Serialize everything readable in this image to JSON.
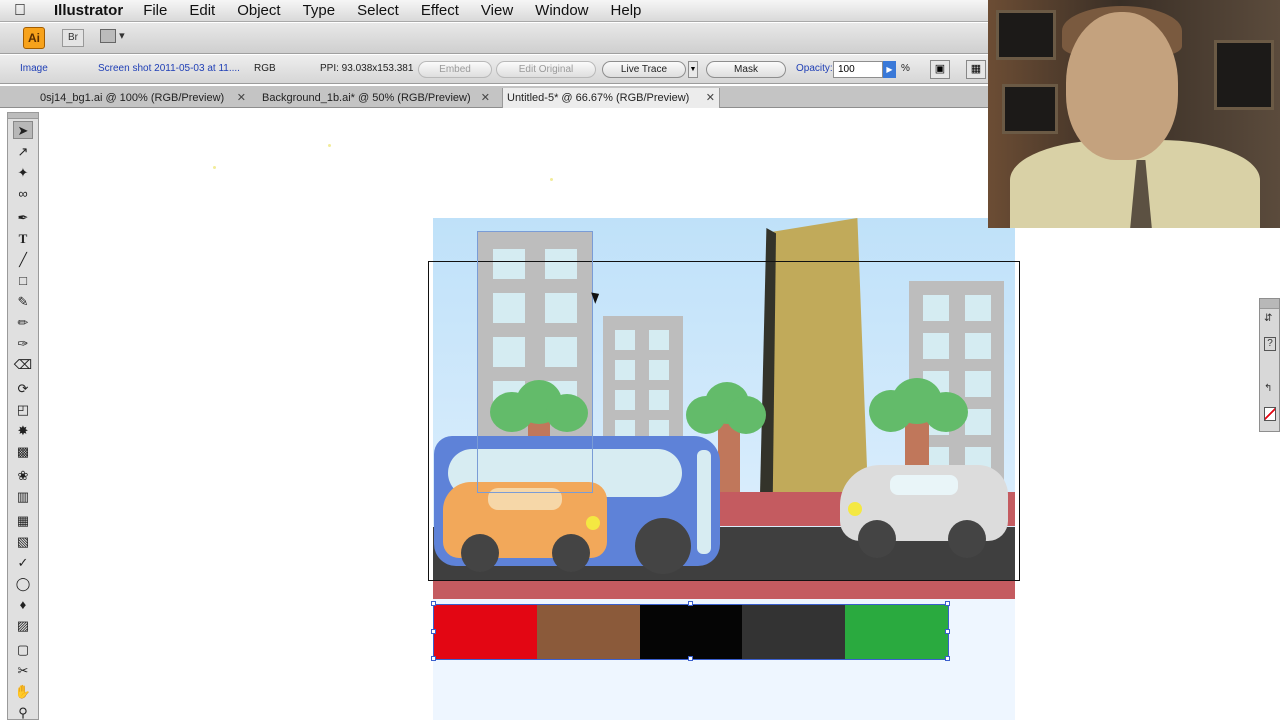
{
  "menu": {
    "app_name": "Illustrator",
    "items": [
      "File",
      "Edit",
      "Object",
      "Type",
      "Select",
      "Effect",
      "View",
      "Window",
      "Help"
    ]
  },
  "appbar": {
    "logo": "Ai",
    "bridge": "Br"
  },
  "control_bar": {
    "object_type": "Image",
    "file_link": "Screen shot 2011-05-03 at 11....",
    "color_mode": "RGB",
    "ppi": "PPI: 93.038x153.381",
    "embed": "Embed",
    "edit_original": "Edit Original",
    "live_trace": "Live Trace",
    "mask": "Mask",
    "opacity_label": "Opacity:",
    "opacity_value": "100",
    "opacity_unit": "%"
  },
  "tabs": [
    {
      "label": "0sj14_bg1.ai @ 100% (RGB/Preview)"
    },
    {
      "label": "Background_1b.ai* @ 50% (RGB/Preview)"
    },
    {
      "label": "Untitled-5* @ 66.67% (RGB/Preview)"
    }
  ],
  "swatch_colors": [
    "#e30613",
    "#8b5a3a",
    "#050505",
    "#333333",
    "#2aaa3f"
  ],
  "accent": "#3a5fcd"
}
